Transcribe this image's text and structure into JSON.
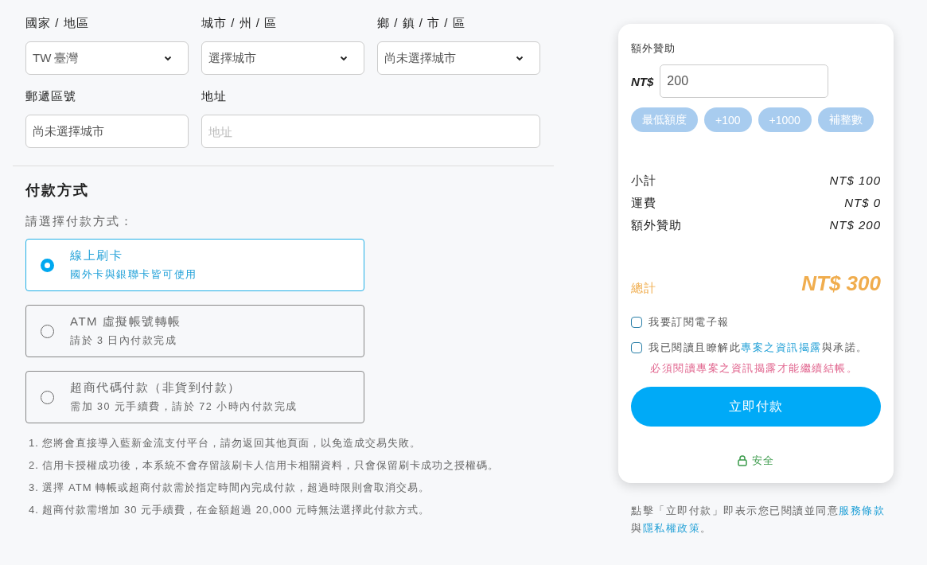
{
  "address": {
    "fields": [
      {
        "label": "國家 / 地區",
        "kind": "select",
        "value": "TW 臺灣"
      },
      {
        "label": "城市 / 州 / 區",
        "kind": "select",
        "value": "選擇城市"
      },
      {
        "label": "鄉 / 鎮 / 市 / 區",
        "kind": "select",
        "value": "尚未選擇城市"
      },
      {
        "label": "郵遞區號",
        "kind": "text",
        "value": "尚未選擇城市"
      },
      {
        "label": "地址",
        "kind": "text",
        "placeholder": "地址"
      }
    ]
  },
  "payment": {
    "title": "付款方式",
    "prompt": "請選擇付款方式：",
    "options": [
      {
        "name": "線上刷卡",
        "note": "國外卡與銀聯卡皆可使用",
        "selected": true
      },
      {
        "name": "ATM 虛擬帳號轉帳",
        "note": "請於 3 日內付款完成",
        "selected": false
      },
      {
        "name": "超商代碼付款（非貨到付款）",
        "note": "需加 30 元手續費，請於 72 小時內付款完成",
        "selected": false
      }
    ],
    "notes": [
      "1. 您將會直接導入藍新金流支付平台，請勿返回其他頁面，以免造成交易失敗。",
      "2. 信用卡授權成功後，本系統不會存留該刷卡人信用卡相關資料，只會保留刷卡成功之授權碼。",
      "3. 選擇 ATM 轉帳或超商付款需於指定時間內完成付款，超過時限則會取消交易。",
      "4. 超商付款需增加 30 元手續費，在金額超過 20,000 元時無法選擇此付款方式。"
    ]
  },
  "summary": {
    "sponsor_label": "額外贊助",
    "currency": "NT$",
    "amount": "200",
    "quick_buttons": [
      "最低額度",
      "+100",
      "+1000",
      "補整數"
    ],
    "lines": [
      {
        "label": "小計",
        "value": "NT$ 100"
      },
      {
        "label": "運費",
        "value": "NT$ 0"
      },
      {
        "label": "額外贊助",
        "value": "NT$ 200"
      }
    ],
    "total": {
      "label": "總計",
      "value": "NT$ 300"
    },
    "checkboxes": [
      {
        "kind": "plain",
        "text": "我要訂閱電子報",
        "checked": false
      },
      {
        "kind": "link",
        "before": "我已閱讀且瞭解此",
        "link": "專案之資訊揭露",
        "after": "與承諾。",
        "checked": false
      }
    ],
    "warning": "必須閱讀專案之資訊揭露才能繼續結帳。",
    "pay_button": "立即付款",
    "secure": "安全"
  },
  "footer": {
    "before": "點擊「立即付款」即表示您已閱讀並同意",
    "link1": "服務條款",
    "middle": "與",
    "link2": "隱私權政策",
    "after": "。"
  }
}
